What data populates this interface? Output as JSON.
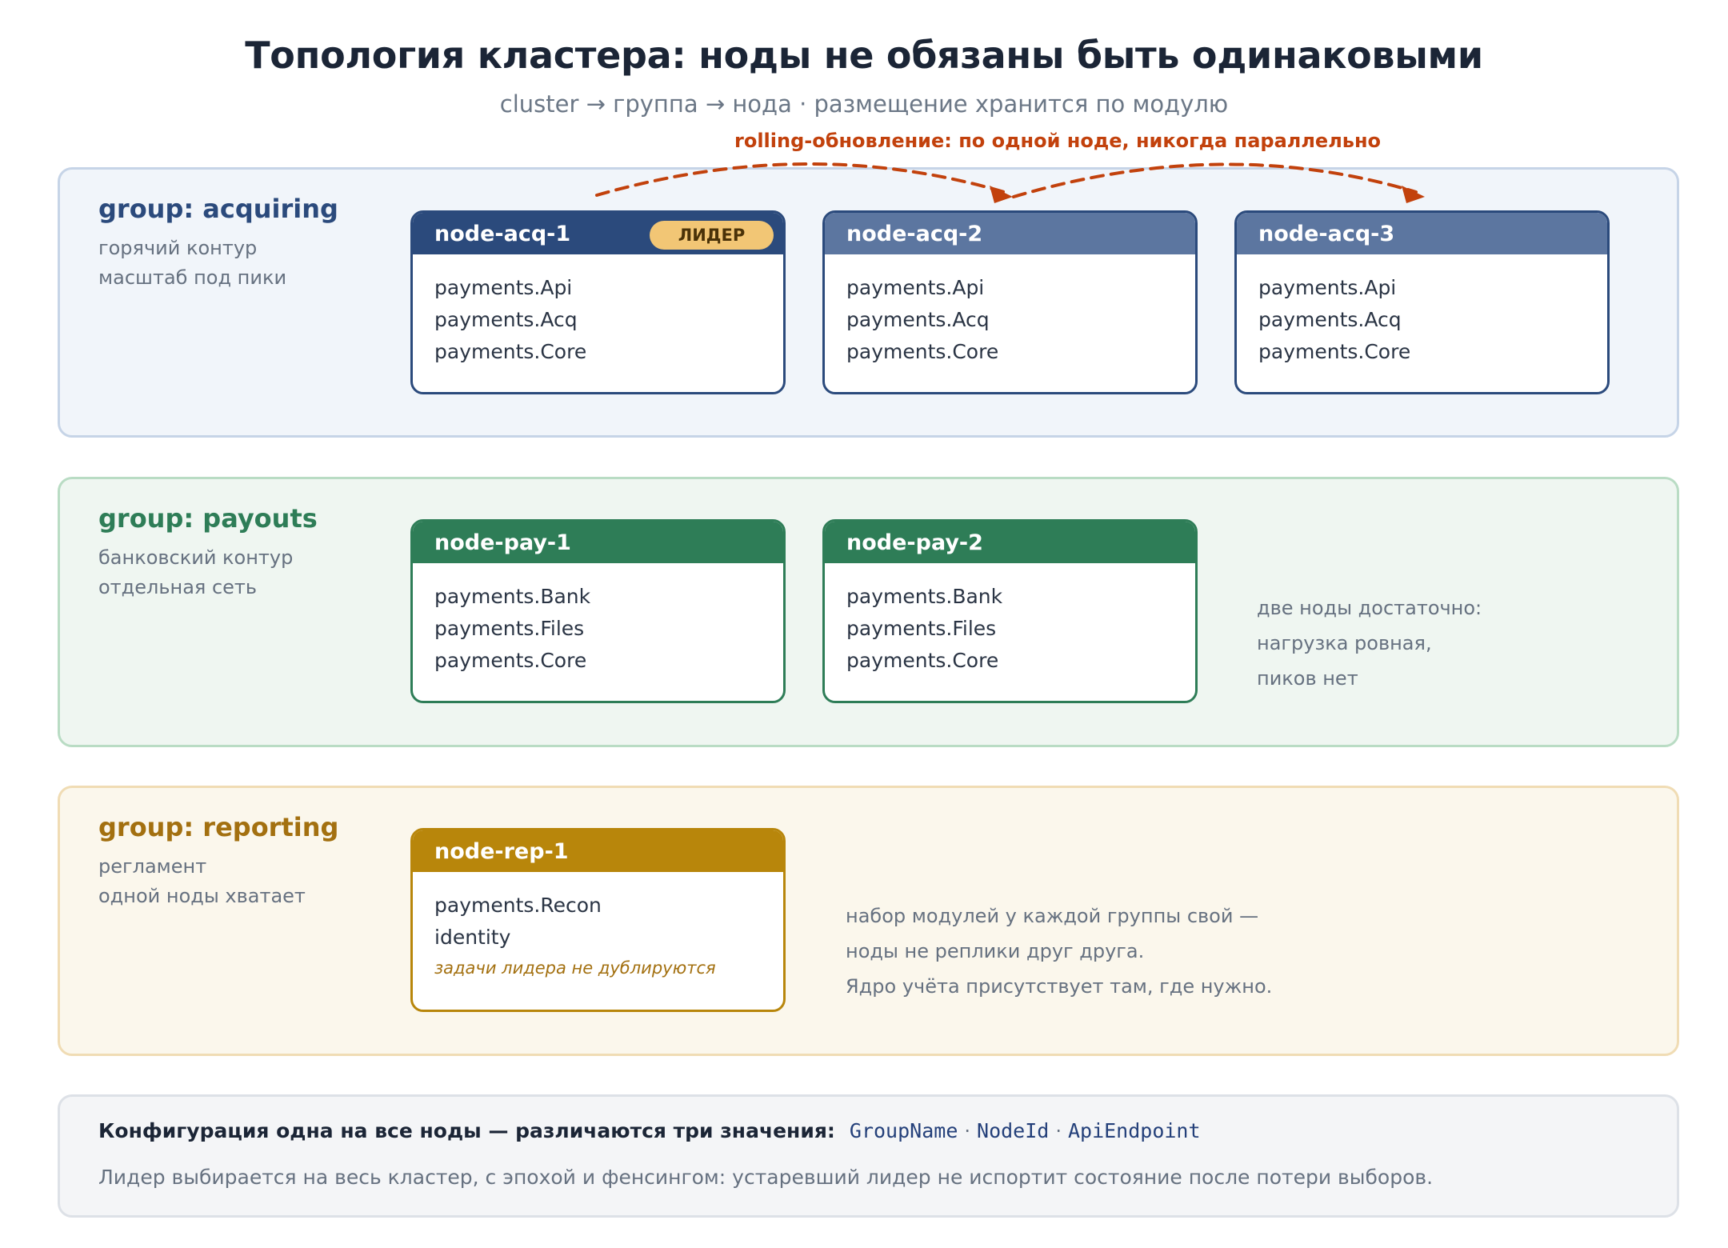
{
  "header": {
    "title": "Топология кластера: ноды не обязаны быть одинаковыми",
    "subtitle": "cluster → группа → нода · размещение хранится по модулю",
    "rolling_label": "rolling-обновление: по одной ноде, никогда параллельно"
  },
  "colors": {
    "acquiring": "#2b4a7c",
    "acquiring_follower_head": "#5c76a0",
    "payouts": "#2e7d57",
    "reporting": "#b8860b",
    "rolling_arrow": "#c2410c",
    "leader_badge": "#f2c675"
  },
  "groups": [
    {
      "title": "group: acquiring",
      "desc": [
        "горячий контур",
        "масштаб под пики"
      ],
      "nodes": [
        {
          "name": "node-acq-1",
          "badge": "ЛИДЕР",
          "modules": [
            "payments.Api",
            "payments.Acq",
            "payments.Core"
          ]
        },
        {
          "name": "node-acq-2",
          "modules": [
            "payments.Api",
            "payments.Acq",
            "payments.Core"
          ]
        },
        {
          "name": "node-acq-3",
          "modules": [
            "payments.Api",
            "payments.Acq",
            "payments.Core"
          ]
        }
      ]
    },
    {
      "title": "group: payouts",
      "desc": [
        "банковский контур",
        "отдельная сеть"
      ],
      "nodes": [
        {
          "name": "node-pay-1",
          "modules": [
            "payments.Bank",
            "payments.Files",
            "payments.Core"
          ]
        },
        {
          "name": "node-pay-2",
          "modules": [
            "payments.Bank",
            "payments.Files",
            "payments.Core"
          ]
        }
      ],
      "note": [
        "две ноды достаточно:",
        "нагрузка ровная,",
        "пиков нет"
      ]
    },
    {
      "title": "group: reporting",
      "desc": [
        "регламент",
        "одной ноды хватает"
      ],
      "nodes": [
        {
          "name": "node-rep-1",
          "modules": [
            "payments.Recon",
            "identity"
          ],
          "note": "задачи лидера не дублируются"
        }
      ],
      "note": [
        "набор модулей у каждой группы свой —",
        "ноды не реплики друг друга.",
        "Ядро учёта присутствует там, где нужно."
      ]
    }
  ],
  "config": {
    "line1_label": "Конфигурация одна на все ноды — различаются три значения:",
    "values": [
      "GroupName",
      "NodeId",
      "ApiEndpoint"
    ],
    "separator": "·",
    "line2": "Лидер выбирается на весь кластер, с эпохой и фенсингом: устаревший лидер не испортит состояние после потери выборов."
  }
}
